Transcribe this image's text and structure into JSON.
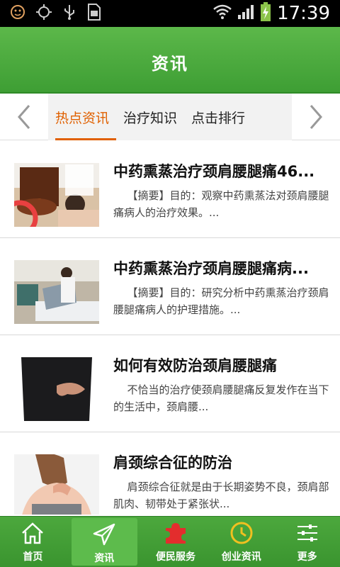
{
  "status_bar": {
    "time": "17:39"
  },
  "header": {
    "title": "资讯"
  },
  "tabs": [
    {
      "label": "热点资讯",
      "active": true
    },
    {
      "label": "治疗知识",
      "active": false
    },
    {
      "label": "点击排行",
      "active": false
    }
  ],
  "articles": [
    {
      "title": "中药熏蒸治疗颈肩腰腿痛46...",
      "summary": "【摘要】目的：观察中药熏蒸法对颈肩腰腿痛病人的治疗效果。..."
    },
    {
      "title": "中药熏蒸治疗颈肩腰腿痛病...",
      "summary": "【摘要】目的：研究分析中药熏蒸治疗颈肩腰腿痛病人的护理措施。..."
    },
    {
      "title": "如何有效防治颈肩腰腿痛",
      "summary": "不恰当的治疗使颈肩腰腿痛反复发作在当下的生活中，颈肩腰..."
    },
    {
      "title": "肩颈综合征的防治",
      "summary": "肩颈综合征就是由于长期姿势不良，颈肩部肌肉、韧带处于紧张状..."
    }
  ],
  "bottom_nav": [
    {
      "label": "首页",
      "icon": "home-icon",
      "active": false
    },
    {
      "label": "资讯",
      "icon": "paper-plane-icon",
      "active": true
    },
    {
      "label": "便民服务",
      "icon": "puzzle-icon",
      "active": false
    },
    {
      "label": "创业资讯",
      "icon": "clock-icon",
      "active": false
    },
    {
      "label": "更多",
      "icon": "sliders-icon",
      "active": false
    }
  ],
  "colors": {
    "header_green": "#4caf3f",
    "tab_active": "#e06000",
    "nav_green": "#3a942f"
  }
}
